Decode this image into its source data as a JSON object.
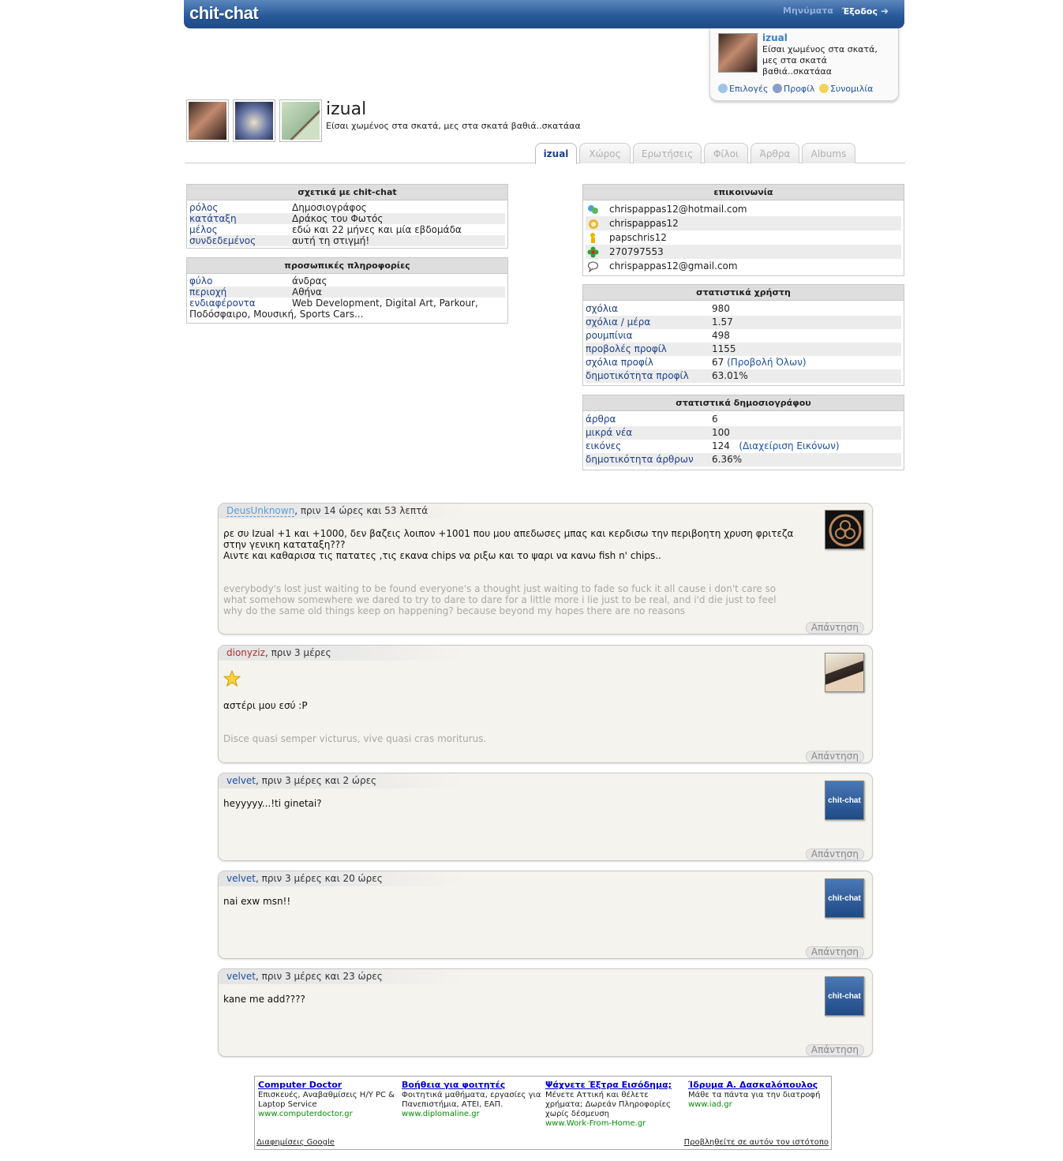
{
  "header": {
    "logo": "chit-chat",
    "messages_label": "Μηνύματα",
    "logout_label": "Έξοδος"
  },
  "user_panel": {
    "name": "izual",
    "status": "Είσαι χωμένος στα σκατά, μες στα σκατά βαθιά..σκατάαα",
    "links": [
      "Επιλογές",
      "Προφίλ",
      "Συνομιλία"
    ]
  },
  "profile": {
    "name": "izual",
    "status": "Είσαι χωμένος στα σκατά, μες στα σκατά βαθιά..σκατάαα"
  },
  "tabs": [
    "izual",
    "Χώρος",
    "Ερωτήσεις",
    "Φίλοι",
    "Άρθρα",
    "Albums"
  ],
  "about_box": {
    "title": "σχετικά με chit-chat",
    "rows": [
      {
        "k": "ρόλος",
        "v": "Δημοσιογράφος"
      },
      {
        "k": "κατάταξη",
        "v": "Δράκος του Φωτός"
      },
      {
        "k": "μέλος",
        "v": "εδώ και 22 μήνες και μία εβδομάδα"
      },
      {
        "k": "συνδεδεμένος",
        "v": "αυτή τη στιγμή!"
      }
    ]
  },
  "personal_box": {
    "title": "προσωπικές πληροφορίες",
    "rows": [
      {
        "k": "φύλο",
        "v": "άνδρας"
      },
      {
        "k": "περιοχή",
        "v": "Αθήνα"
      }
    ],
    "interests_key": "ενδιαφέροντα",
    "interests_value": "Web Development, Digital Art, Parkour, Ποδόσφαιρο, Μουσική, Sports Cars..."
  },
  "contact_box": {
    "title": "επικοινωνία",
    "rows": [
      {
        "icon": "msn-icon",
        "v": "chrispappas12@hotmail.com"
      },
      {
        "icon": "yahoo-icon",
        "v": "chrispappas12"
      },
      {
        "icon": "aim-icon",
        "v": "papschris12"
      },
      {
        "icon": "icq-icon",
        "v": "270797553"
      },
      {
        "icon": "gtalk-icon",
        "v": "chrispappas12@gmail.com"
      }
    ]
  },
  "user_stats": {
    "title": "στατιστικά χρήστη",
    "rows": [
      {
        "k": "σχόλια",
        "v": "980"
      },
      {
        "k": "σχόλια / μέρα",
        "v": "1.57"
      },
      {
        "k": "ρουμπίνια",
        "v": "498"
      },
      {
        "k": "προβολές προφίλ",
        "v": "1155"
      },
      {
        "k": "σχόλια προφίλ",
        "v": "67",
        "link": "(Προβολή Όλων)"
      },
      {
        "k": "δημοτικότητα προφίλ",
        "v": "63.01%"
      }
    ]
  },
  "journalist_stats": {
    "title": "στατιστικά δημοσιογράφου",
    "rows": [
      {
        "k": "άρθρα",
        "v": "6"
      },
      {
        "k": "μικρά νέα",
        "v": "100"
      },
      {
        "k": "εικόνες",
        "v": "124",
        "link": "(Διαχείριση Εικόνων)"
      },
      {
        "k": "δημοτικότητα άρθρων",
        "v": "6.36%"
      }
    ]
  },
  "comments": [
    {
      "author": "DeusUnknown",
      "time": ", πριν 14 ώρες και 53 λεπτά",
      "body": [
        "ρε συ Izual +1 και +1000, δεν βαζεις λοιπον +1001 που μου απεδωσες μπας και κερδισω την περιβοητη χρυση φριτεζα",
        "στην γενικη καταταξη???",
        "Αιντε και καθαρισα τις πατατες ,τις εκανα chips να ριξω και το ψαρι να κανω fish n' chips.."
      ],
      "signature": [
        "everybody's lost just waiting to be found everyone's a thought just waiting to fade so fuck it all cause i don't care so",
        "what somehow somewhere we dared to try to dare to dare for a little more i lie just to be real, and i'd die just to feel",
        "why do the same old things keep on happening? because beyond my hopes there are no reasons"
      ],
      "reply": "Απάντηση"
    },
    {
      "author": "dionyziz",
      "time": ", πριν 3 μέρες",
      "body": [
        "αστέρι μου εσύ :P"
      ],
      "signature": [
        "Disce quasi semper victurus, vive quasi cras moriturus."
      ],
      "reply": "Απάντηση"
    },
    {
      "author": "velvet",
      "time": ", πριν 3 μέρες και 2 ώρες",
      "body": [
        "heyyyyy...!ti ginetai?"
      ],
      "avatar_text": "chit-chat",
      "reply": "Απάντηση"
    },
    {
      "author": "velvet",
      "time": ", πριν 3 μέρες και 20 ώρες",
      "body": [
        "nai exw msn!!"
      ],
      "avatar_text": "chit-chat",
      "reply": "Απάντηση"
    },
    {
      "author": "velvet",
      "time": ", πριν 3 μέρες και 23 ώρες",
      "body": [
        "kane me add????"
      ],
      "avatar_text": "chit-chat",
      "reply": "Απάντηση"
    }
  ],
  "ads": {
    "items": [
      {
        "title": "Computer Doctor",
        "desc": "Επισκευές, Αναβαθμίσεις Η/Υ PC & Laptop Service",
        "url": "www.computerdoctor.gr"
      },
      {
        "title": "Βοήθεια για φοιτητές",
        "desc": "Φοιτητικά μαθήματα, εργασίες για Πανεπιστήμια, ΑΤΕΙ, ΕΑΠ.",
        "url": "www.diplomaline.gr"
      },
      {
        "title": "Ψάχνετε Έξτρα Εισόδημα;",
        "desc": "Μένετε Αττική και θέλετε χρήματα; Δωρεάν Πληροφορίες χωρίς δέσμευση",
        "url": "www.Work-From-Home.gr"
      },
      {
        "title": "Ίδρυμα Α. Δασκαλόπουλος",
        "desc": "Μάθε τα πάντα για την διατροφή",
        "url": "www.iad.gr"
      }
    ],
    "footer_left": "Διαφημίσεις Google",
    "footer_right": "Προβληθείτε σε αυτόν τον ιστότοπο"
  }
}
